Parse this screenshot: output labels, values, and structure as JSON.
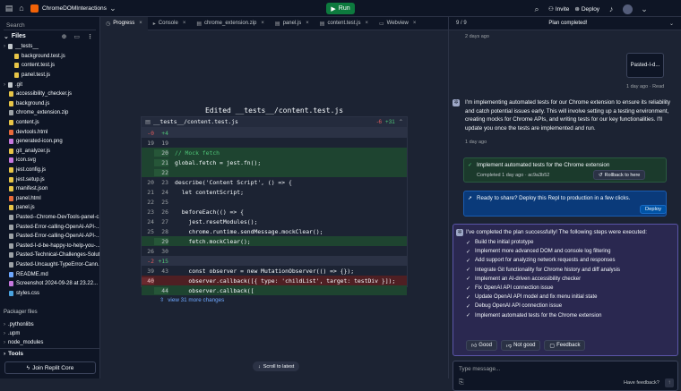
{
  "topbar": {
    "project_name": "ChromeDOMInteractions",
    "run_label": "Run",
    "invite_label": "Invite",
    "deploy_label": "Deploy"
  },
  "sidebar": {
    "search_placeholder": "Search",
    "files_title": "Files",
    "items": [
      {
        "label": "__tests__",
        "kind": "folder"
      },
      {
        "label": "background.test.js",
        "kind": "js"
      },
      {
        "label": "content.test.js",
        "kind": "js"
      },
      {
        "label": "panel.test.js",
        "kind": "js"
      },
      {
        "label": ".git",
        "kind": "folder"
      },
      {
        "label": "accessibility_checker.js",
        "kind": "js"
      },
      {
        "label": "background.js",
        "kind": "js"
      },
      {
        "label": "chrome_extension.zip",
        "kind": "zip"
      },
      {
        "label": "content.js",
        "kind": "js"
      },
      {
        "label": "devtools.html",
        "kind": "html"
      },
      {
        "label": "generated-icon.png",
        "kind": "img"
      },
      {
        "label": "git_analyzer.js",
        "kind": "js"
      },
      {
        "label": "icon.svg",
        "kind": "img"
      },
      {
        "label": "jest.config.js",
        "kind": "js"
      },
      {
        "label": "jest.setup.js",
        "kind": "js"
      },
      {
        "label": "manifest.json",
        "kind": "json"
      },
      {
        "label": "panel.html",
        "kind": "html"
      },
      {
        "label": "panel.js",
        "kind": "js"
      },
      {
        "label": "Pasted--Chrome-DevTools-panel-c...",
        "kind": "txt"
      },
      {
        "label": "Pasted-Error-calling-OpenAI-API-...",
        "kind": "txt"
      },
      {
        "label": "Pasted-Error-calling-OpenAI-API-...",
        "kind": "txt"
      },
      {
        "label": "Pasted-I-d-be-happy-to-help-you-...",
        "kind": "txt"
      },
      {
        "label": "Pasted-Technical-Challenges-Solut...",
        "kind": "txt"
      },
      {
        "label": "Pasted-Uncaught-TypeError-Cann...",
        "kind": "txt"
      },
      {
        "label": "README.md",
        "kind": "md"
      },
      {
        "label": "Screenshot 2024-09-28 at 23.22...",
        "kind": "img"
      },
      {
        "label": "styles.css",
        "kind": "css"
      }
    ],
    "packager_title": "Packager files",
    "packager_items": [
      ".pythonlibs",
      ".upm",
      "node_modules"
    ],
    "tools_label": "Tools",
    "join_label": "Join Replit Core"
  },
  "tabs": [
    "Progress",
    "Console",
    "chrome_extension.zip",
    "panel.js",
    "content.test.js",
    "Webview"
  ],
  "editor": {
    "edited_title": "Edited __tests__/content.test.js",
    "file_name": "__tests__/content.test.js",
    "minus": "-6",
    "plus": "+31",
    "more_changes": "view 31 more changes",
    "scroll_label": "Scroll to latest",
    "lines": [
      {
        "t": "hunk",
        "a": "-0",
        "b": "+4",
        "code": ""
      },
      {
        "t": "ctx",
        "a": "19",
        "b": "19",
        "code": ""
      },
      {
        "t": "add",
        "a": "",
        "b": "20",
        "code": "// Mock fetch"
      },
      {
        "t": "add",
        "a": "",
        "b": "21",
        "code": "global.fetch = jest.fn();"
      },
      {
        "t": "add",
        "a": "",
        "b": "22",
        "code": ""
      },
      {
        "t": "ctx",
        "a": "20",
        "b": "23",
        "code": "describe('Content Script', () => {"
      },
      {
        "t": "ctx",
        "a": "21",
        "b": "24",
        "code": "  let contentScript;"
      },
      {
        "t": "ctx",
        "a": "22",
        "b": "25",
        "code": ""
      },
      {
        "t": "ctx",
        "a": "23",
        "b": "26",
        "code": "  beforeEach(() => {"
      },
      {
        "t": "ctx",
        "a": "24",
        "b": "27",
        "code": "    jest.resetModules();"
      },
      {
        "t": "ctx",
        "a": "25",
        "b": "28",
        "code": "    chrome.runtime.sendMessage.mockClear();"
      },
      {
        "t": "add",
        "a": "",
        "b": "29",
        "code": "    fetch.mockClear();"
      },
      {
        "t": "ctx",
        "a": "26",
        "b": "30",
        "code": ""
      },
      {
        "t": "hunk",
        "a": "-2",
        "b": "+15",
        "code": ""
      },
      {
        "t": "ctx",
        "a": "39",
        "b": "43",
        "code": "    const observer = new MutationObserver(() => {});"
      },
      {
        "t": "del",
        "a": "40",
        "b": "",
        "code": "    observer.callback([{ type: 'childList', target: testDiv }]);"
      },
      {
        "t": "add",
        "a": "",
        "b": "44",
        "code": "    observer.callback(["
      }
    ]
  },
  "right": {
    "step_counter": "9 / 9",
    "header_title": "Plan completed!",
    "ago1": "2 days ago",
    "attachment": "Pasted-I-d...",
    "ago2": "1 day ago",
    "read": "Read",
    "message": "I'm implementing automated tests for our Chrome extension to ensure its reliability and catch potential issues early. This will involve setting up a testing environment, creating mocks for Chrome APIs, and writing tests for our key functionalities. I'll update you once the tests are implemented and run.",
    "ago3": "1 day ago",
    "checkpoint_title": "Implement automated tests for the Chrome extension",
    "checkpoint_meta": "Completed 1 day ago",
    "checkpoint_hash": "ac9a3b52",
    "rollback_label": "Rollback to here",
    "share_text": "Ready to share? Deploy this Repl to production in a few clicks.",
    "deploy_label": "Deploy",
    "done_text": "I've completed the plan successfully! The following steps were executed:",
    "steps": [
      "Build the initial prototype",
      "Implement more advanced DOM and console log filtering",
      "Add support for analyzing network requests and responses",
      "Integrate Git functionality for Chrome history and diff analysis",
      "Implement an AI-driven accessibility checker",
      "Fix OpenAI API connection issue",
      "Update OpenAI API model and fix menu initial state",
      "Debug OpenAI API connection issue",
      "Implement automated tests for the Chrome extension"
    ],
    "good": "Good",
    "not_good": "Not good",
    "feedback": "Feedback",
    "input_placeholder": "Type message...",
    "have_feedback": "Have feedback?"
  },
  "colors": {
    "bg": "#1c2333",
    "panel": "#0e1525",
    "accent": "#0053a6",
    "success": "#0d7a3e",
    "checkpoint": "#1b3a2c"
  }
}
